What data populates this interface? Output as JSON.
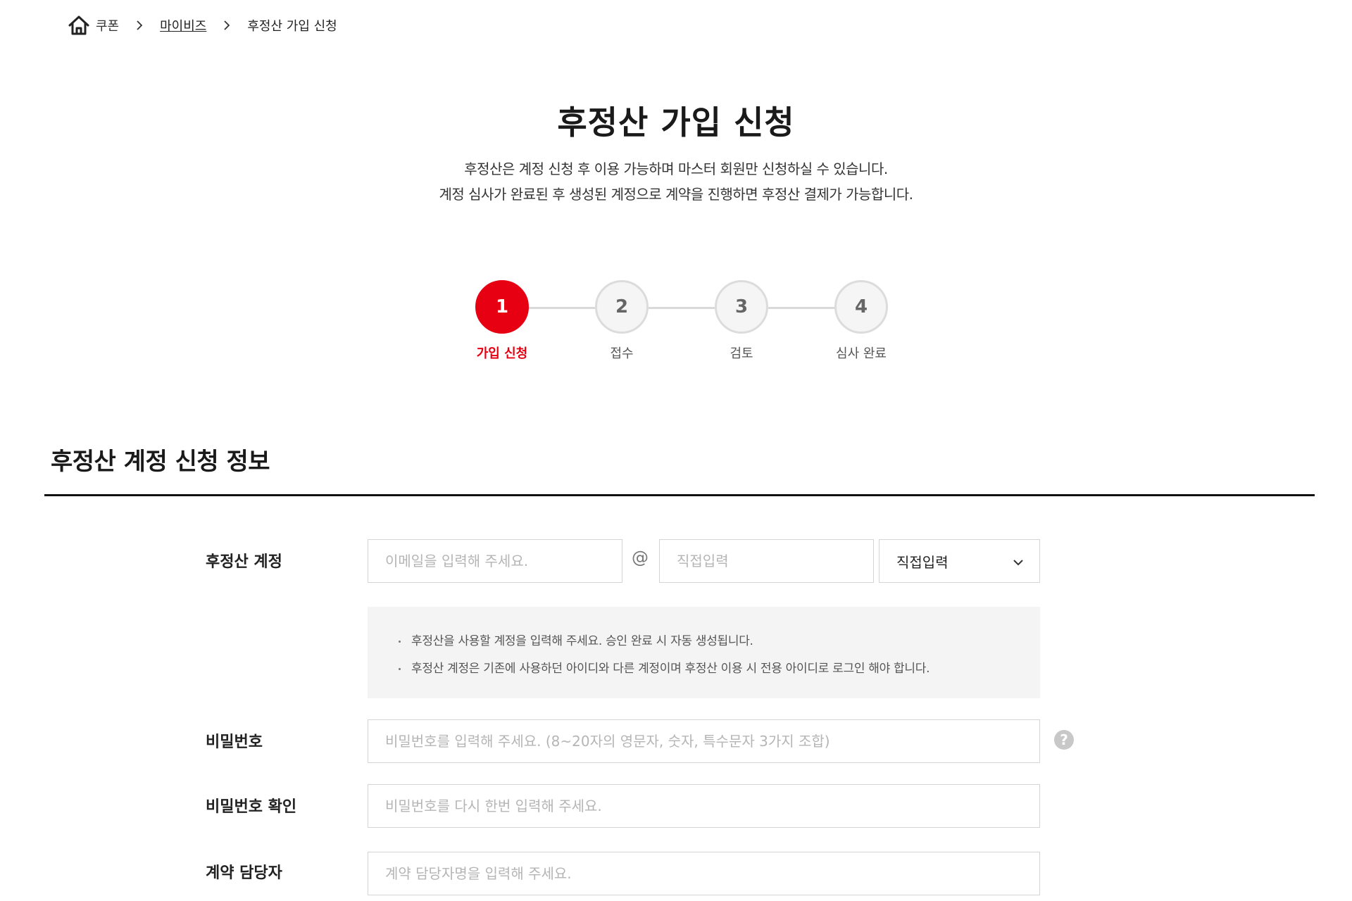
{
  "breadcrumb": {
    "home_label": "쿠폰",
    "items": [
      "마이비즈",
      "후정산 가입 신청"
    ]
  },
  "header": {
    "title": "후정산 가입 신청",
    "description_lines": [
      "후정산은 계정 신청 후 이용 가능하며 마스터 회원만 신청하실 수 있습니다.",
      "계정 심사가 완료된 후 생성된 계정으로 계약을 진행하면 후정산 결제가 가능합니다."
    ]
  },
  "stepper": {
    "current_step": 1,
    "steps": [
      {
        "number": "1",
        "label": "가입 신청"
      },
      {
        "number": "2",
        "label": "접수"
      },
      {
        "number": "3",
        "label": "검토"
      },
      {
        "number": "4",
        "label": "심사 완료"
      }
    ],
    "active_color": "#e60012"
  },
  "section": {
    "title": "후정산 계정 신청 정보"
  },
  "form": {
    "account": {
      "label": "후정산 계정",
      "email_placeholder": "이메일을 입력해 주세요.",
      "at_sign": "@",
      "domain_placeholder": "직접입력",
      "domain_select_value": "직접입력"
    },
    "notice": [
      "후정산을 사용할 계정을 입력해 주세요. 승인 완료 시 자동 생성됩니다.",
      "후정산 계정은 기존에 사용하던 아이디와 다른 계정이며 후정산 이용 시 전용 아이디로 로그인 해야 합니다."
    ],
    "password": {
      "label": "비밀번호",
      "placeholder": "비밀번호를 입력해 주세요. (8~20자의 영문자, 숫자, 특수문자 3가지 조합)",
      "help_icon": "?"
    },
    "password_confirm": {
      "label": "비밀번호 확인",
      "placeholder": "비밀번호를 다시 한번 입력해 주세요."
    },
    "contract_manager": {
      "label": "계약 담당자",
      "placeholder": "계약 담당자명을 입력해 주세요."
    }
  },
  "colors": {
    "accent": "#e60012",
    "notice_bg": "#f4f4f4",
    "input_border": "#d4d4d4"
  }
}
